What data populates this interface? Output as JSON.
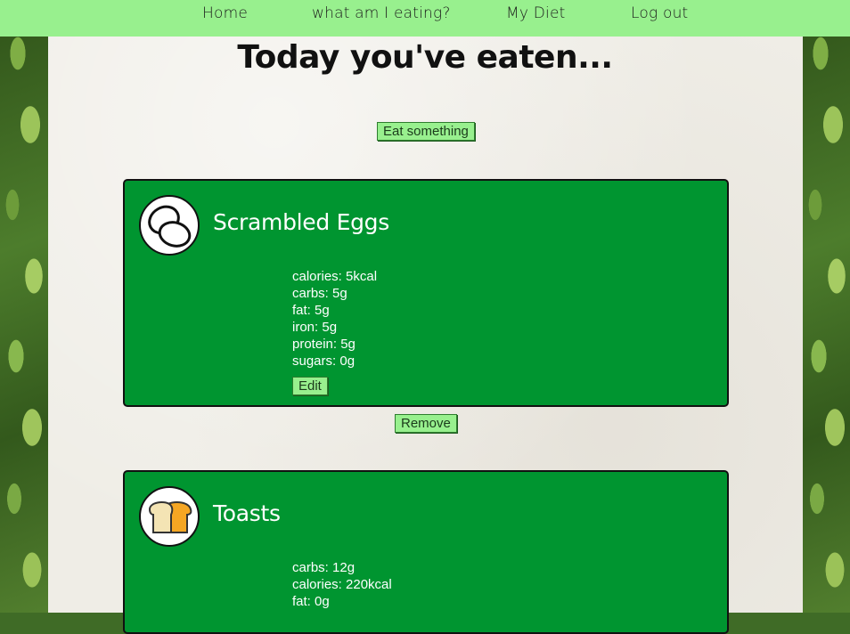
{
  "nav": {
    "home": "Home",
    "what": "what am I eating?",
    "diet": "My Diet",
    "logout": "Log out"
  },
  "page": {
    "title": "Today you've eaten...",
    "eat_button": "Eat something",
    "remove_button": "Remove"
  },
  "foods": [
    {
      "name": "Scrambled Eggs",
      "icon": "eggs-icon",
      "nutrients": [
        "calories: 5kcal",
        "carbs: 5g",
        "fat: 5g",
        "iron: 5g",
        "protein: 5g",
        "sugars: 0g"
      ],
      "edit_label": "Edit"
    },
    {
      "name": "Toasts",
      "icon": "bread-icon",
      "nutrients": [
        "carbs: 12g",
        "calories: 220kcal",
        "fat: 0g"
      ]
    }
  ],
  "colors": {
    "nav_bg": "#98f08e",
    "card_bg": "#009530",
    "paper_bg": "#efede6"
  }
}
